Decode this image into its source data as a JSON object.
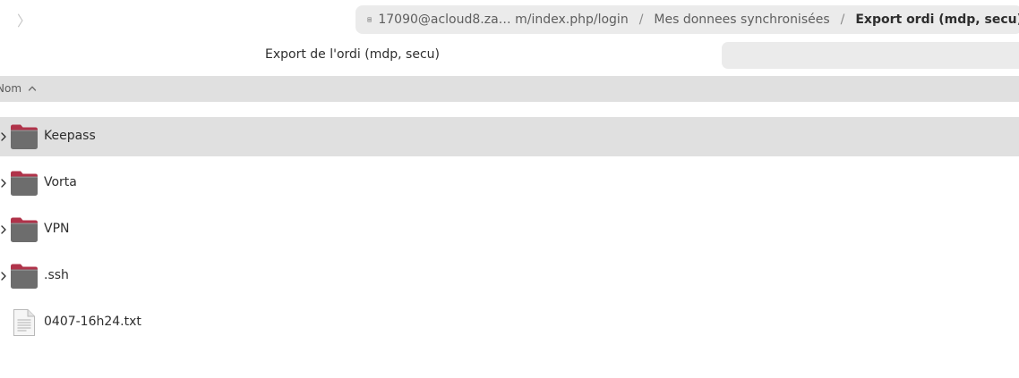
{
  "header": {
    "forward_glyph": "〉",
    "breadcrumbs": [
      {
        "label": "17090@acloud8.za…  m/index.php/login"
      },
      {
        "label": "Mes donnees synchronisées"
      },
      {
        "label": "Export ordi (mdp, secu)"
      }
    ],
    "separator": "/",
    "server_icon": "server-icon"
  },
  "toolbar": {
    "location_label": "Export de l'ordi (mdp, secu)",
    "search_value": ""
  },
  "columns": {
    "name_label": "Nom",
    "sort_direction": "ascending"
  },
  "files": [
    {
      "name": "Keepass",
      "kind": "folder",
      "selected": true
    },
    {
      "name": "Vorta",
      "kind": "folder",
      "selected": false
    },
    {
      "name": "VPN",
      "kind": "folder",
      "selected": false
    },
    {
      "name": ".ssh",
      "kind": "folder",
      "selected": false
    },
    {
      "name": "0407-16h24.txt",
      "kind": "text-file",
      "selected": false
    }
  ],
  "colors": {
    "folder_top": "#b0334a",
    "folder_body": "#6d6d6d",
    "selection": "#e0e0e0",
    "pathbar": "#ebebeb"
  }
}
